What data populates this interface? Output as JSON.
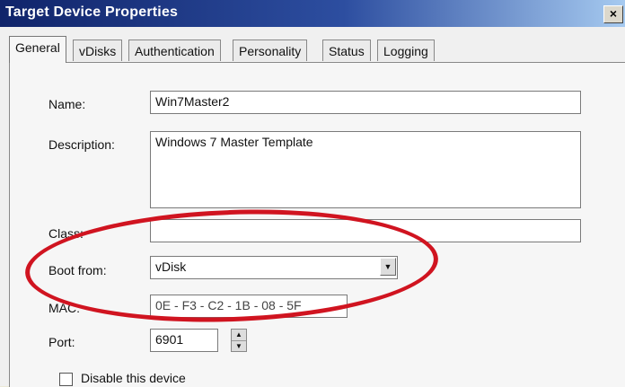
{
  "window": {
    "title": "Target Device Properties",
    "close_glyph": "×"
  },
  "tabs": [
    "General",
    "vDisks",
    "Authentication",
    "Personality",
    "Status",
    "Logging"
  ],
  "form": {
    "name_label": "Name:",
    "name_value": "Win7Master2",
    "description_label": "Description:",
    "description_value": "Windows 7 Master Template",
    "class_label": "Class:",
    "class_value": "",
    "boot_label": "Boot from:",
    "boot_value": "vDisk",
    "mac_label": "MAC:",
    "mac_value": "0E - F3 - C2 - 1B - 08 - 5F",
    "port_label": "Port:",
    "port_value": "6901",
    "disable_label": "Disable this device"
  },
  "colors": {
    "annotation_oval": "#d01420",
    "title_bar": "#10246a"
  }
}
